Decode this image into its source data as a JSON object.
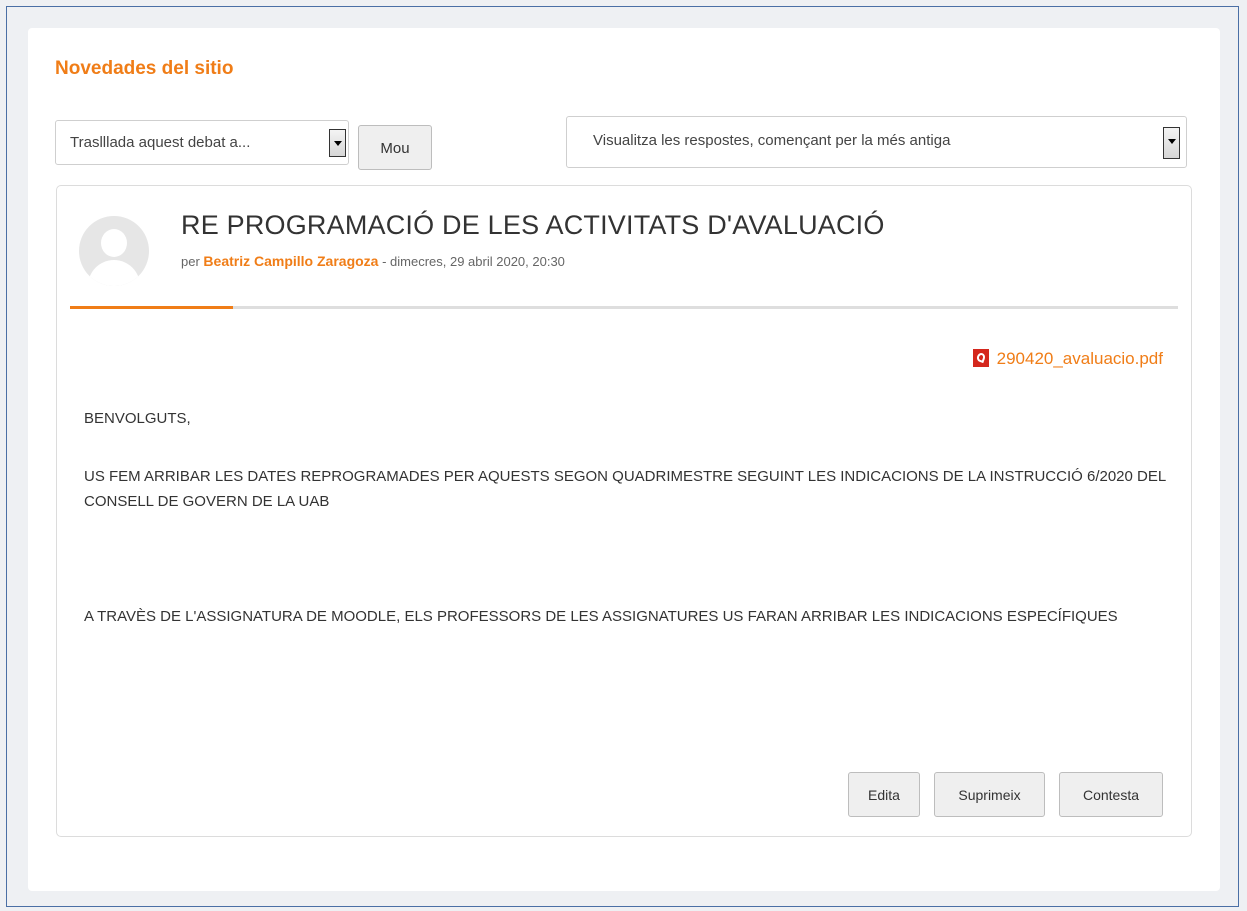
{
  "forum": {
    "title": "Novedades del sitio",
    "move_select_value": "Traslllada aquest debat a...",
    "move_button_label": "Mou",
    "display_mode_value": "Visualitza les respostes, començant per la més antiga"
  },
  "post": {
    "subject": "RE PROGRAMACIÓ DE LES ACTIVITATS D'AVALUACIÓ",
    "by_prefix": "per",
    "author": "Beatriz Campillo Zaragoza",
    "date_text": " - dimecres, 29 abril 2020, 20:30",
    "attachment": "290420_avaluacio.pdf",
    "body": [
      "BENVOLGUTS,",
      "US FEM ARRIBAR LES DATES REPROGRAMADES PER AQUESTS SEGON QUADRIMESTRE SEGUINT LES INDICACIONS DE LA INSTRUCCIÓ 6/2020 DEL CONSELL DE GOVERN DE LA UAB",
      "A TRAVÈS DE L'ASSIGNATURA DE MOODLE, ELS PROFESSORS DE LES ASSIGNATURES US FARAN ARRIBAR LES INDICACIONS ESPECÍFIQUES"
    ],
    "actions": {
      "edit": "Edita",
      "delete": "Suprimeix",
      "reply": "Contesta"
    }
  },
  "colors": {
    "accent": "#f07d17",
    "pdf_icon": "#d4271d"
  },
  "icons": {
    "avatar": "default-user-avatar",
    "attachment": "pdf-icon",
    "dropdown": "chevron-down-icon"
  }
}
